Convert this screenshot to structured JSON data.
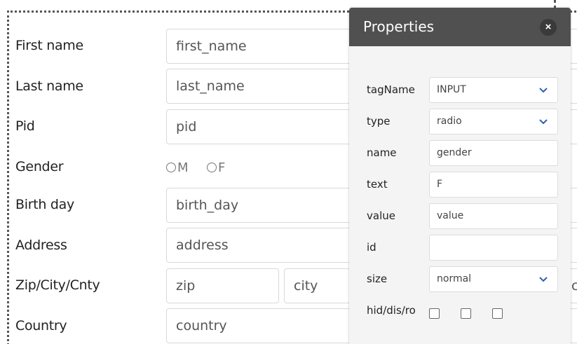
{
  "form": {
    "rows": [
      {
        "label": "First name",
        "placeholder": "first_name"
      },
      {
        "label": "Last name",
        "placeholder": "last_name"
      },
      {
        "label": "Pid",
        "placeholder": "pid"
      },
      {
        "label": "Gender"
      },
      {
        "label": "Birth day",
        "placeholder": "birth_day"
      },
      {
        "label": "Address",
        "placeholder": "address"
      },
      {
        "label": "Zip/City/Cnty",
        "placeholder_zip": "zip",
        "placeholder_city": "city",
        "placeholder_cnty_partial": "co"
      },
      {
        "label": "Country",
        "placeholder": "country"
      }
    ],
    "gender_options": [
      "M",
      "F"
    ]
  },
  "panel": {
    "title": "Properties",
    "close": "×",
    "props": [
      {
        "label": "tagName",
        "value": "INPUT",
        "type": "select"
      },
      {
        "label": "type",
        "value": "radio",
        "type": "select"
      },
      {
        "label": "name",
        "value": "gender",
        "type": "text"
      },
      {
        "label": "text",
        "value": "F",
        "type": "text"
      },
      {
        "label": "value",
        "value": "value",
        "type": "text"
      },
      {
        "label": "id",
        "value": "",
        "type": "text"
      },
      {
        "label": "size",
        "value": "normal",
        "type": "select"
      }
    ],
    "flags_label": "hid/dis/ro"
  },
  "colors": {
    "header_bg": "#505050",
    "chevron": "#2f5fb0"
  }
}
